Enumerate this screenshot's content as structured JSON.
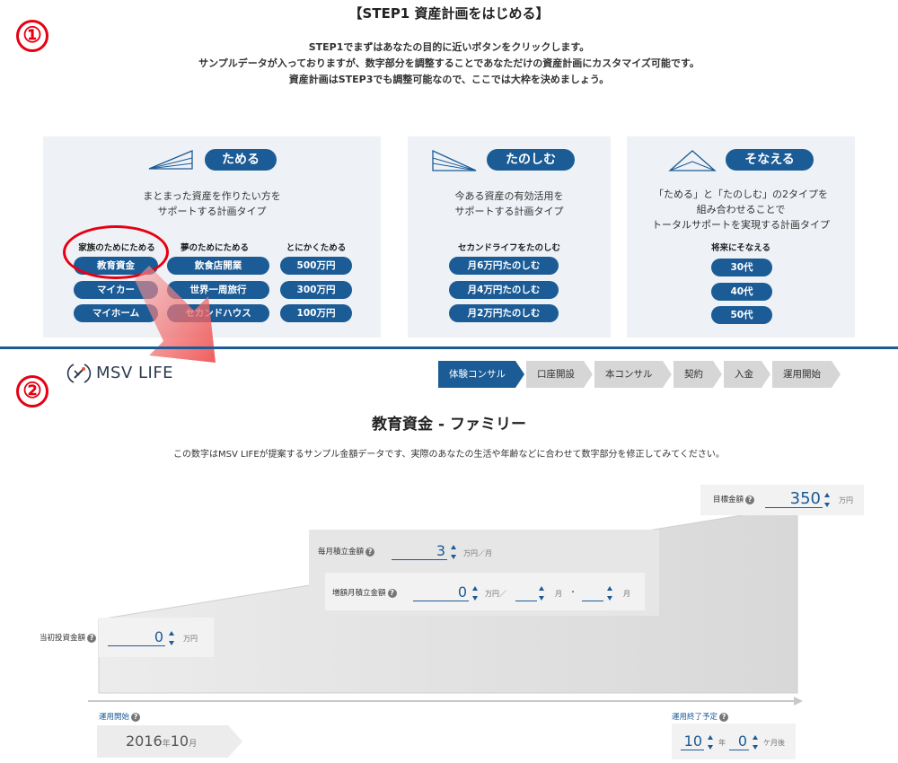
{
  "markers": {
    "one": "①",
    "two": "②"
  },
  "step1": {
    "title": "【STEP1 資産計画をはじめる】",
    "intro": [
      "STEP1でまずはあなたの目的に近いボタンをクリックします。",
      "サンプルデータが入っておりますが、数字部分を調整することであなただけの資産計画にカスタマイズ可能です。",
      "資産計画はSTEP3でも調整可能なので、ここでは大枠を決めましょう。"
    ],
    "panels": {
      "tameru": {
        "label": "ためる",
        "icon": "triangle-rising-icon",
        "desc": [
          "まとまった資産を作りたい方を",
          "サポートする計画タイプ"
        ],
        "columns": [
          {
            "title": "家族のためにためる",
            "options": [
              "教育資金",
              "マイカー",
              "マイホーム"
            ]
          },
          {
            "title": "夢のためにためる",
            "options": [
              "飲食店開業",
              "世界一周旅行",
              "セカンドハウス"
            ]
          },
          {
            "title": "とにかくためる",
            "options": [
              "500万円",
              "300万円",
              "100万円"
            ]
          }
        ]
      },
      "tanoshimu": {
        "label": "たのしむ",
        "icon": "triangle-falling-icon",
        "desc": [
          "今ある資産の有効活用を",
          "サポートする計画タイプ"
        ],
        "columns": [
          {
            "title": "セカンドライフをたのしむ",
            "options": [
              "月6万円たのしむ",
              "月4万円たのしむ",
              "月2万円たのしむ"
            ]
          }
        ]
      },
      "sonaeru": {
        "label": "そなえる",
        "icon": "triangle-peak-icon",
        "desc": [
          "「ためる」と「たのしむ」の2タイプを",
          "組み合わせることで",
          "トータルサポートを実現する計画タイプ"
        ],
        "columns": [
          {
            "title": "将来にそなえる",
            "options": [
              "30代",
              "40代",
              "50代"
            ]
          }
        ]
      }
    },
    "accent_color": "#1b5b96",
    "highlight_color": "#e60012"
  },
  "step2": {
    "logo": "MSV LIFE",
    "steps": [
      "体験コンサル",
      "口座開設",
      "本コンサル",
      "契約",
      "入金",
      "運用開始"
    ],
    "active_step": "体験コンサル",
    "title": "教育資金 - ファミリー",
    "note": "この数字はMSV LIFEが提案するサンプル金額データです、実際のあなたの生活や年齢などに合わせて数字部分を修正してみてください。",
    "help_glyph": "?",
    "target": {
      "label": "目標金額",
      "value": "350",
      "unit": "万円"
    },
    "monthly": {
      "label": "毎月積立金額",
      "value": "3",
      "unit": "万円／月"
    },
    "increase": {
      "label": "増額月積立金額",
      "value": "0",
      "unit": "万円／",
      "month1_unit": "月",
      "separator": "・",
      "month2_unit": "月"
    },
    "initial": {
      "label": "当初投資金額",
      "value": "0",
      "unit": "万円"
    },
    "start": {
      "label": "運用開始",
      "year": "2016",
      "year_unit": "年",
      "month": "10",
      "month_unit": "月"
    },
    "end": {
      "label": "運用終了予定",
      "years": "10",
      "years_unit": "年",
      "months": "0",
      "months_unit": "ケ月後"
    }
  }
}
